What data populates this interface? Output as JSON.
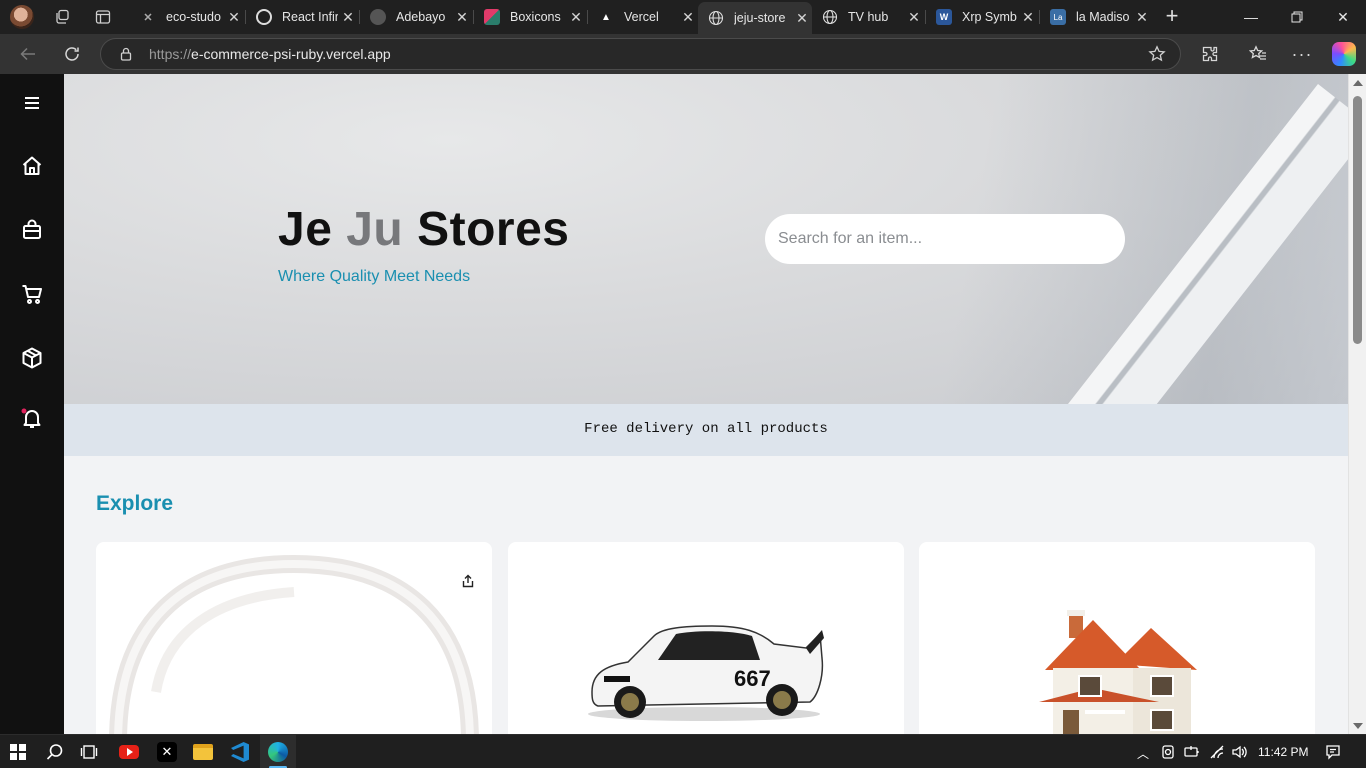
{
  "browser": {
    "tabs": [
      {
        "title": "eco-studo",
        "favicon": "x-logo-icon"
      },
      {
        "title": "React Infir",
        "favicon": "openai-icon"
      },
      {
        "title": "Adebayo",
        "favicon": "github-icon"
      },
      {
        "title": "Boxicons",
        "favicon": "boxicons-icon"
      },
      {
        "title": "Vercel",
        "favicon": "vercel-icon"
      },
      {
        "title": "jeju-store",
        "favicon": "globe-icon",
        "active": true
      },
      {
        "title": "TV hub",
        "favicon": "globe-icon"
      },
      {
        "title": "Xrp Symb",
        "favicon": "word-icon"
      },
      {
        "title": "la Madiso",
        "favicon": "la-icon"
      }
    ],
    "url_scheme": "https://",
    "url_host": "e-commerce-psi-ruby.vercel.app"
  },
  "sidebar": {
    "items": [
      {
        "icon": "menu-icon"
      },
      {
        "icon": "home-icon"
      },
      {
        "icon": "shopping-bag-icon"
      },
      {
        "icon": "cart-icon"
      },
      {
        "icon": "package-icon"
      },
      {
        "icon": "bell-icon"
      }
    ]
  },
  "hero": {
    "brand_part1": "Je ",
    "brand_part2": "Ju",
    "brand_part3": " Stores",
    "tagline": "Where Quality Meet Needs",
    "search_placeholder": "Search for an item..."
  },
  "promo": {
    "text": "Free delivery on all products"
  },
  "explore": {
    "title": "Explore",
    "products": [
      {
        "image": "headphones-image"
      },
      {
        "image": "race-car-image",
        "car_number": "667"
      },
      {
        "image": "house-image"
      }
    ]
  },
  "taskbar": {
    "time": "11:42 PM"
  },
  "colors": {
    "accent": "#1a8fb0",
    "sidebar": "#111111",
    "promo_bg": "#dde4ec"
  }
}
